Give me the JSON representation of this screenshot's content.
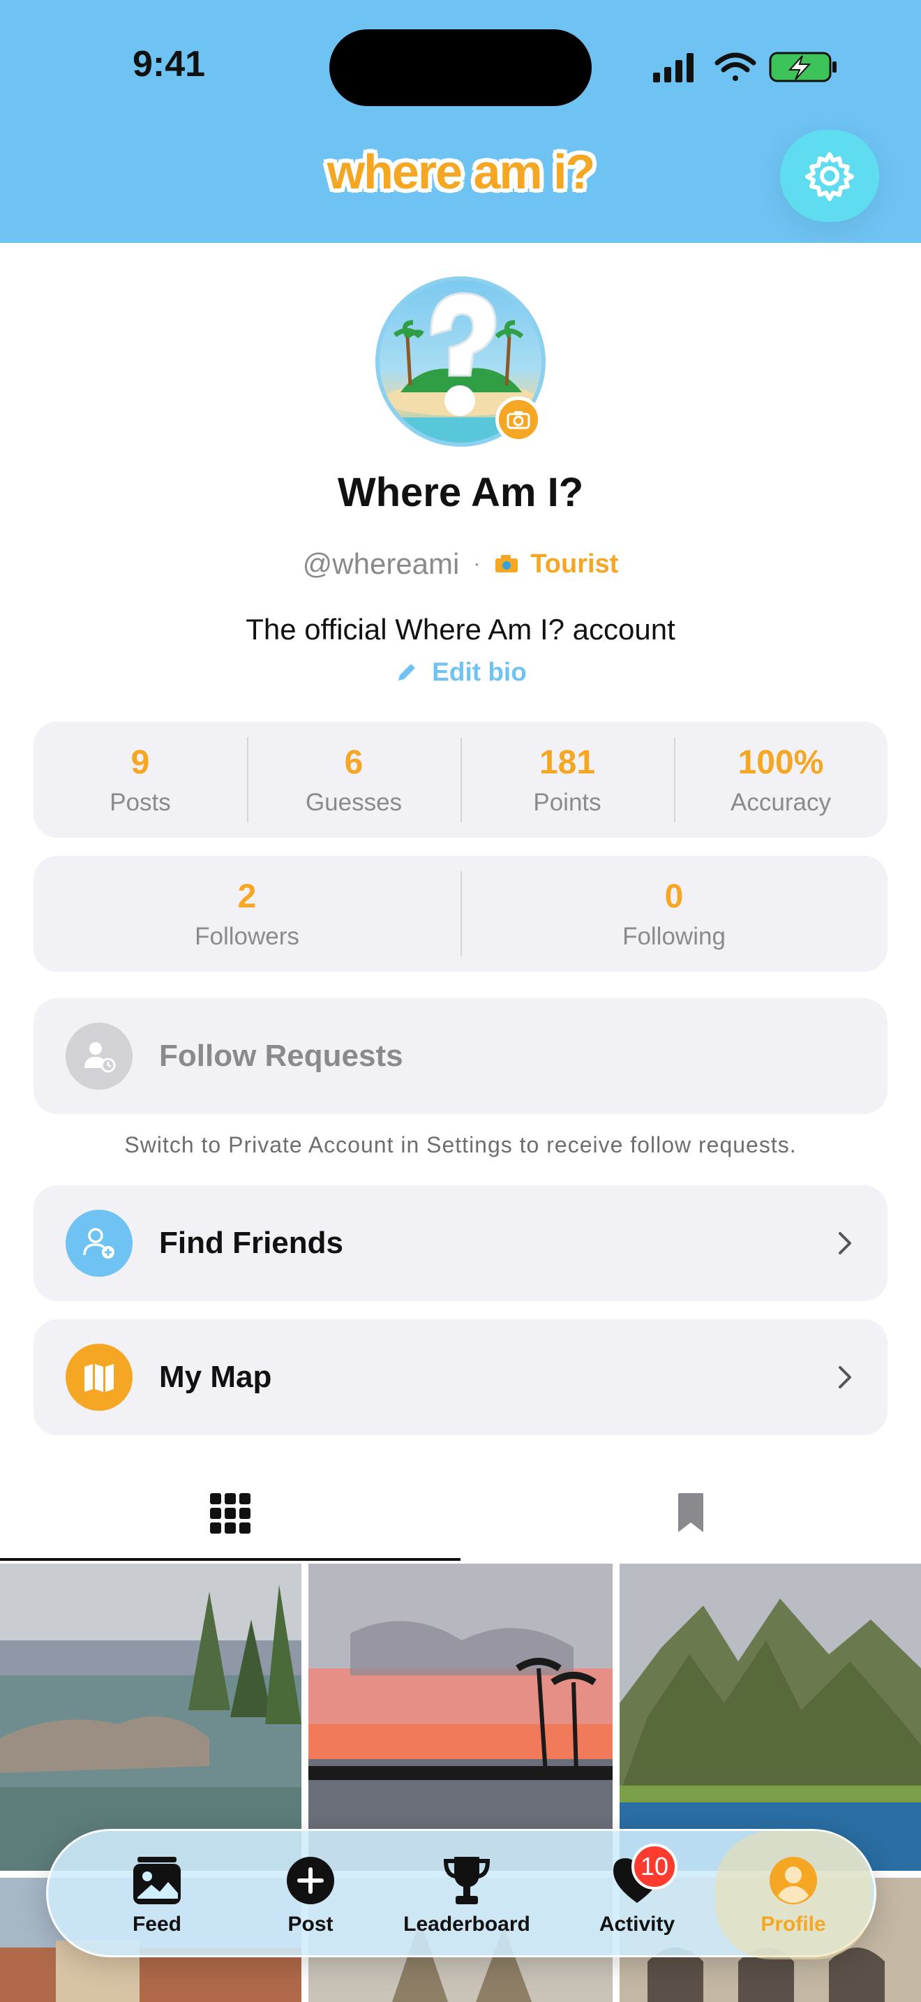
{
  "status_bar": {
    "time": "9:41"
  },
  "header": {
    "logo_text": "where am i?"
  },
  "profile": {
    "display_name": "Where Am I?",
    "handle": "@whereami",
    "separator": "·",
    "rank": "Tourist",
    "bio": "The official Where Am I? account",
    "edit_bio_label": "Edit bio"
  },
  "stats": [
    {
      "value": "9",
      "label": "Posts"
    },
    {
      "value": "6",
      "label": "Guesses"
    },
    {
      "value": "181",
      "label": "Points"
    },
    {
      "value": "100%",
      "label": "Accuracy"
    }
  ],
  "follow_stats": [
    {
      "value": "2",
      "label": "Followers"
    },
    {
      "value": "0",
      "label": "Following"
    }
  ],
  "follow_requests": {
    "label": "Follow Requests",
    "note": "Switch to Private Account in Settings to receive follow requests."
  },
  "find_friends": {
    "label": "Find Friends"
  },
  "my_map": {
    "label": "My Map"
  },
  "tab_bar": {
    "items": [
      {
        "label": "Feed"
      },
      {
        "label": "Post"
      },
      {
        "label": "Leaderboard"
      },
      {
        "label": "Activity",
        "badge": "10"
      },
      {
        "label": "Profile"
      }
    ]
  },
  "colors": {
    "sky_blue": "#6ec3f2",
    "accent_orange": "#f5a623",
    "card_gray": "#f1f1f6",
    "badge_red": "#ff3b30"
  },
  "icons": [
    "settings-gear-icon",
    "camera-icon",
    "pencil-icon",
    "user-clock-icon",
    "user-plus-icon",
    "map-icon",
    "grid-icon",
    "bookmark-icon",
    "photos-icon",
    "plus-icon",
    "trophy-icon",
    "heart-icon",
    "person-icon"
  ]
}
